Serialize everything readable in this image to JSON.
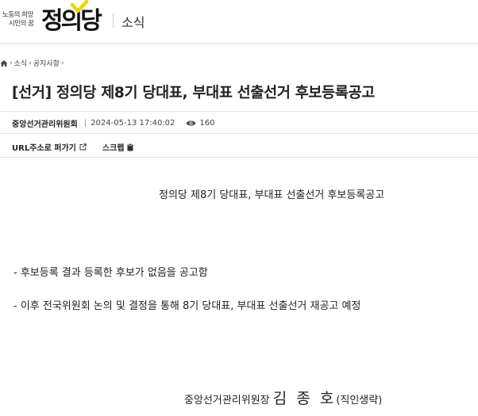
{
  "header": {
    "slogan_line1": "노동의 희망",
    "slogan_line2": "시민의 꿈",
    "logo_text": "정의당",
    "section": "소식"
  },
  "breadcrumb": {
    "items": [
      "소식",
      "공지사항"
    ]
  },
  "post": {
    "title": "[선거] 정의당 제8기 당대표, 부대표 선출선거 후보등록공고",
    "author": "중앙선거관리위원회",
    "datetime": "2024-05-13 17:40:02",
    "views": "160",
    "url_share_label": "URL주소로 퍼가기",
    "scrap_label": "스크랩"
  },
  "content": {
    "heading": "정의당 제8기 당대표, 부대표 선출선거 후보등록공고",
    "line1": "- 후보등록 결과 등록한 후보가 없음을 공고함",
    "line2": "- 이후 전국위원회 논의 및 결정을 통해 8기 당대표, 부대표 선출선거 재공고 예정",
    "sign_title": "중앙선거관리위원장",
    "sign_name": "김 종 호",
    "sign_seal": "(직인생략)"
  },
  "colors": {
    "accent_yellow": "#e6d800",
    "text": "#222222",
    "rule": "#e4e4e4"
  }
}
